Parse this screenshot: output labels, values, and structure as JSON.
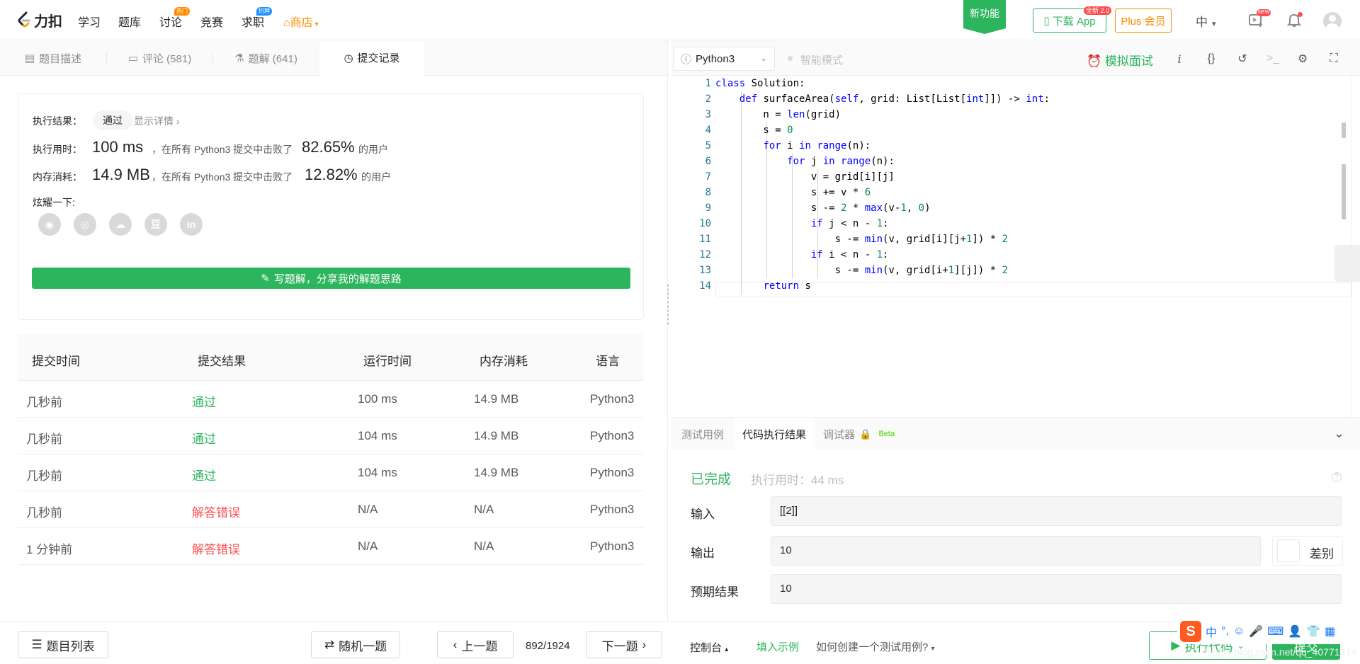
{
  "nav": {
    "logo_text": "力扣",
    "items": [
      {
        "label": "学习"
      },
      {
        "label": "题库"
      },
      {
        "label": "讨论",
        "badge": "热门",
        "badge_color": "#ff8a00"
      },
      {
        "label": "竞赛"
      },
      {
        "label": "求职",
        "badge": "招聘",
        "badge_color": "#1890ff"
      }
    ],
    "store": "商店",
    "new_feature": "新功能",
    "download_app": "下载 App",
    "download_tag": "全新 2.0",
    "plus": "Plus 会员",
    "lang": "中",
    "new_tag": "NEW"
  },
  "left_tabs": [
    {
      "label": "题目描述",
      "icon": "description-icon"
    },
    {
      "label": "评论 (581)",
      "icon": "comment-icon"
    },
    {
      "label": "题解 (641)",
      "icon": "flask-icon"
    },
    {
      "label": "提交记录",
      "icon": "clock-icon",
      "active": true
    }
  ],
  "result": {
    "result_label": "执行结果：",
    "result_value": "通过",
    "details_link": "显示详情 ›",
    "time_label": "执行用时：",
    "time_value": "100 ms",
    "time_mid": "，在所有 Python3 提交中击败了",
    "time_pct": "82.65%",
    "time_suffix": "的用户",
    "mem_label": "内存消耗：",
    "mem_value": "14.9 MB",
    "mem_mid": "，在所有 Python3 提交中击败了",
    "mem_pct": "12.82%",
    "mem_suffix": "的用户",
    "share_label": "炫耀一下:",
    "share_icons": [
      "wechat-icon",
      "weibo-icon",
      "qq-icon",
      "douban-icon",
      "linkedin-icon"
    ],
    "share_glyphs": [
      "◉",
      "◎",
      "☁",
      "豆",
      "in"
    ],
    "write_solution": "写题解，分享我的解题思路"
  },
  "submissions": {
    "headers": [
      "提交时间",
      "提交结果",
      "运行时间",
      "内存消耗",
      "语言"
    ],
    "rows": [
      {
        "time": "几秒前",
        "result": "通过",
        "status": "ok",
        "runtime": "100 ms",
        "memory": "14.9 MB",
        "lang": "Python3"
      },
      {
        "time": "几秒前",
        "result": "通过",
        "status": "ok",
        "runtime": "104 ms",
        "memory": "14.9 MB",
        "lang": "Python3"
      },
      {
        "time": "几秒前",
        "result": "通过",
        "status": "ok",
        "runtime": "104 ms",
        "memory": "14.9 MB",
        "lang": "Python3"
      },
      {
        "time": "几秒前",
        "result": "解答错误",
        "status": "err",
        "runtime": "N/A",
        "memory": "N/A",
        "lang": "Python3"
      },
      {
        "time": "1 分钟前",
        "result": "解答错误",
        "status": "err",
        "runtime": "N/A",
        "memory": "N/A",
        "lang": "Python3"
      }
    ]
  },
  "editor": {
    "language": "Python3",
    "smart_mode": "智能模式",
    "mock_interview": "模拟面试",
    "code_lines": [
      "class Solution:",
      "    def surfaceArea(self, grid: List[List[int]]) -> int:",
      "        n = len(grid)",
      "        s = 0",
      "        for i in range(n):",
      "            for j in range(n):",
      "                v = grid[i][j]",
      "                s += v * 6",
      "                s -= 2 * max(v-1, 0)",
      "                if j < n - 1:",
      "                    s -= min(v, grid[i][j+1]) * 2",
      "                if i < n - 1:",
      "                    s -= min(v, grid[i+1][j]) * 2",
      "        return s"
    ]
  },
  "console": {
    "tabs": [
      "测试用例",
      "代码执行结果",
      "调试器"
    ],
    "beta": "Beta",
    "status": "已完成",
    "exec_time": "执行用时：44 ms",
    "input_label": "输入",
    "input_value": "[[2]]",
    "output_label": "输出",
    "output_value": "10",
    "diff_label": "差别",
    "expected_label": "预期结果",
    "expected_value": "10"
  },
  "bottom": {
    "problem_list": "题目列表",
    "random": "随机一题",
    "prev": "上一题",
    "page": "892/1924",
    "next": "下一题",
    "console": "控制台",
    "fill_example": "填入示例",
    "how_create": "如何创建一个测试用例?",
    "run_code": "执行代码",
    "submit": "提交",
    "watermark": "https://blog.csdn.net/qq_40771374"
  },
  "ime": {
    "logo": "S",
    "mode": "中"
  }
}
